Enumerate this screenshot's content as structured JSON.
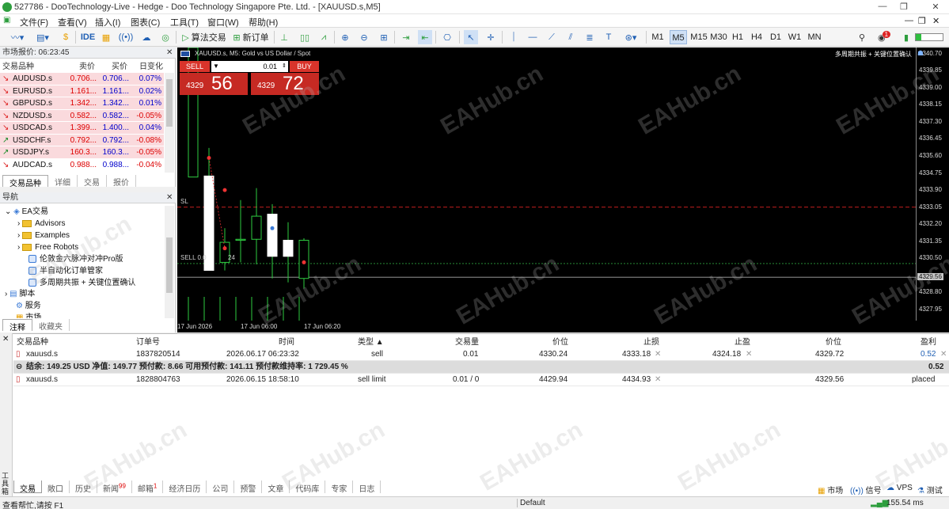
{
  "window": {
    "title": "527786 - DooTechnology-Live - Hedge - Doo Technology Singapore Pte. Ltd. - [XAUUSD.s,M5]"
  },
  "menu": [
    "文件(F)",
    "查看(V)",
    "插入(I)",
    "图表(C)",
    "工具(T)",
    "窗口(W)",
    "帮助(H)"
  ],
  "toolbar": {
    "algo_trading": "算法交易",
    "new_order": "新订单",
    "ide": "IDE",
    "timeframes": [
      "M1",
      "M5",
      "M15",
      "M30",
      "H1",
      "H4",
      "D1",
      "W1",
      "MN"
    ],
    "active_timeframe": "M5",
    "notification_count": "1"
  },
  "market_watch": {
    "title": "市场报价: 06:23:45",
    "columns": [
      "交易品种",
      "卖价",
      "买价",
      "日变化"
    ],
    "rows": [
      {
        "symbol": "AUDUSD.s",
        "bid": "0.706...",
        "ask": "0.706...",
        "change": "0.07%",
        "dir": "dn"
      },
      {
        "symbol": "EURUSD.s",
        "bid": "1.161...",
        "ask": "1.161...",
        "change": "0.02%",
        "dir": "dn"
      },
      {
        "symbol": "GBPUSD.s",
        "bid": "1.342...",
        "ask": "1.342...",
        "change": "0.01%",
        "dir": "dn"
      },
      {
        "symbol": "NZDUSD.s",
        "bid": "0.582...",
        "ask": "0.582...",
        "change": "-0.05%",
        "dir": "dn"
      },
      {
        "symbol": "USDCAD.s",
        "bid": "1.399...",
        "ask": "1.400...",
        "change": "0.04%",
        "dir": "dn"
      },
      {
        "symbol": "USDCHF.s",
        "bid": "0.792...",
        "ask": "0.792...",
        "change": "-0.08%",
        "dir": "up"
      },
      {
        "symbol": "USDJPY.s",
        "bid": "160.3...",
        "ask": "160.3...",
        "change": "-0.05%",
        "dir": "up"
      },
      {
        "symbol": "AUDCAD.s",
        "bid": "0.988...",
        "ask": "0.988...",
        "change": "-0.04%",
        "dir": "dn"
      }
    ],
    "tabs": [
      "交易品种",
      "详细",
      "交易",
      "报价"
    ]
  },
  "navigator": {
    "title": "导航",
    "root": "EA交易",
    "items": [
      "Advisors",
      "Examples",
      "Free Robots",
      "伦敦金六脉冲对冲Pro版",
      "半自动化订单管家",
      "多周期共振 + 关键位置确认"
    ],
    "scripts": "脚本",
    "services": "服务",
    "market": "市场",
    "tabs": [
      "注释",
      "收藏夹"
    ]
  },
  "chart": {
    "symbol_title": "XAUUSD.s, M5:  Gold vs US Dollar / Spot",
    "ea_label": "多周期共振 + 关键位置确认",
    "sell_label": "SELL",
    "buy_label": "BUY",
    "volume": "0.01",
    "sell_price_small": "4329",
    "sell_price_big": "56",
    "buy_price_small": "4329",
    "buy_price_big": "72",
    "sl_label": "SL",
    "sell_line_label": "SELL 0.0",
    "sell_line_price_tail": "24",
    "current_price": "4329.56",
    "y_ticks": [
      "4340.70",
      "4339.85",
      "4339.00",
      "4338.15",
      "4337.30",
      "4336.45",
      "4335.60",
      "4334.75",
      "4333.90",
      "4333.05",
      "4332.20",
      "4331.35",
      "4330.50",
      "4329.56",
      "4328.80",
      "4327.95"
    ],
    "x_ticks": [
      "17 Jun 2026",
      "17 Jun 06:00",
      "17 Jun 06:20"
    ]
  },
  "chart_data": {
    "type": "candlestick",
    "title": "XAUUSD.s, M5:  Gold vs US Dollar / Spot",
    "x_labels": [
      "17 Jun 2026",
      "17 Jun 06:00",
      "17 Jun 06:20"
    ],
    "ylim": [
      4327.4,
      4341.0
    ],
    "candles": [
      {
        "o": 4334.55,
        "h": 4341.0,
        "l": 4334.55,
        "c": 4341.0
      },
      {
        "o": 4334.6,
        "h": 4336.0,
        "l": 4329.9,
        "c": 4329.9
      },
      {
        "o": 4330.3,
        "h": 4332.0,
        "l": 4329.9,
        "c": 4331.3
      },
      {
        "o": 4331.4,
        "h": 4333.4,
        "l": 4330.3,
        "c": 4331.45
      },
      {
        "o": 4331.45,
        "h": 4334.0,
        "l": 4330.2,
        "c": 4332.6
      },
      {
        "o": 4332.7,
        "h": 4333.2,
        "l": 4329.5,
        "c": 4330.6
      },
      {
        "o": 4331.4,
        "h": 4332.3,
        "l": 4329.3,
        "c": 4330.6
      },
      {
        "o": 4329.5,
        "h": 4331.5,
        "l": 4329.0,
        "c": 4331.4
      }
    ],
    "levels": {
      "sl": 4333.05,
      "sell_entry": 4330.24,
      "current": 4329.56
    }
  },
  "trade_table": {
    "columns": [
      "交易品种",
      "订单号",
      "时间",
      "类型",
      "交易量",
      "价位",
      "止损",
      "止盈",
      "价位",
      "盈利"
    ],
    "position": {
      "symbol": "xauusd.s",
      "ticket": "1837820514",
      "time": "2026.06.17 06:23:32",
      "type": "sell",
      "volume": "0.01",
      "price": "4330.24",
      "sl": "4333.18",
      "tp": "4324.18",
      "current": "4329.72",
      "profit": "0.52"
    },
    "balance_line": "结余: 149.25 USD  净值: 149.77  预付款: 8.66  可用预付款: 141.11  预付款维持率: 1 729.45 %",
    "balance_profit": "0.52",
    "order": {
      "symbol": "xauusd.s",
      "ticket": "1828804763",
      "time": "2026.06.15 18:58:10",
      "type": "sell limit",
      "volume": "0.01 / 0",
      "price": "4429.94",
      "sl": "4434.93",
      "tp": "",
      "current": "4329.56",
      "status": "placed"
    }
  },
  "bottom_tabs": [
    {
      "label": "交易",
      "badge": ""
    },
    {
      "label": "敞口",
      "badge": ""
    },
    {
      "label": "历史",
      "badge": ""
    },
    {
      "label": "新闻",
      "badge": "99"
    },
    {
      "label": "邮箱",
      "badge": "1"
    },
    {
      "label": "经济日历",
      "badge": ""
    },
    {
      "label": "公司",
      "badge": ""
    },
    {
      "label": "预警",
      "badge": ""
    },
    {
      "label": "文章",
      "badge": ""
    },
    {
      "label": "代码库",
      "badge": ""
    },
    {
      "label": "专家",
      "badge": ""
    },
    {
      "label": "日志",
      "badge": ""
    }
  ],
  "right_status": {
    "market": "市场",
    "signals": "信号",
    "vps": "VPS",
    "tester": "测试"
  },
  "vertical_label": "工具箱",
  "status": {
    "help": "查看帮忙,请按 F1",
    "profile": "Default",
    "ping": "155.54 ms"
  },
  "watermark": "EAHub.cn"
}
